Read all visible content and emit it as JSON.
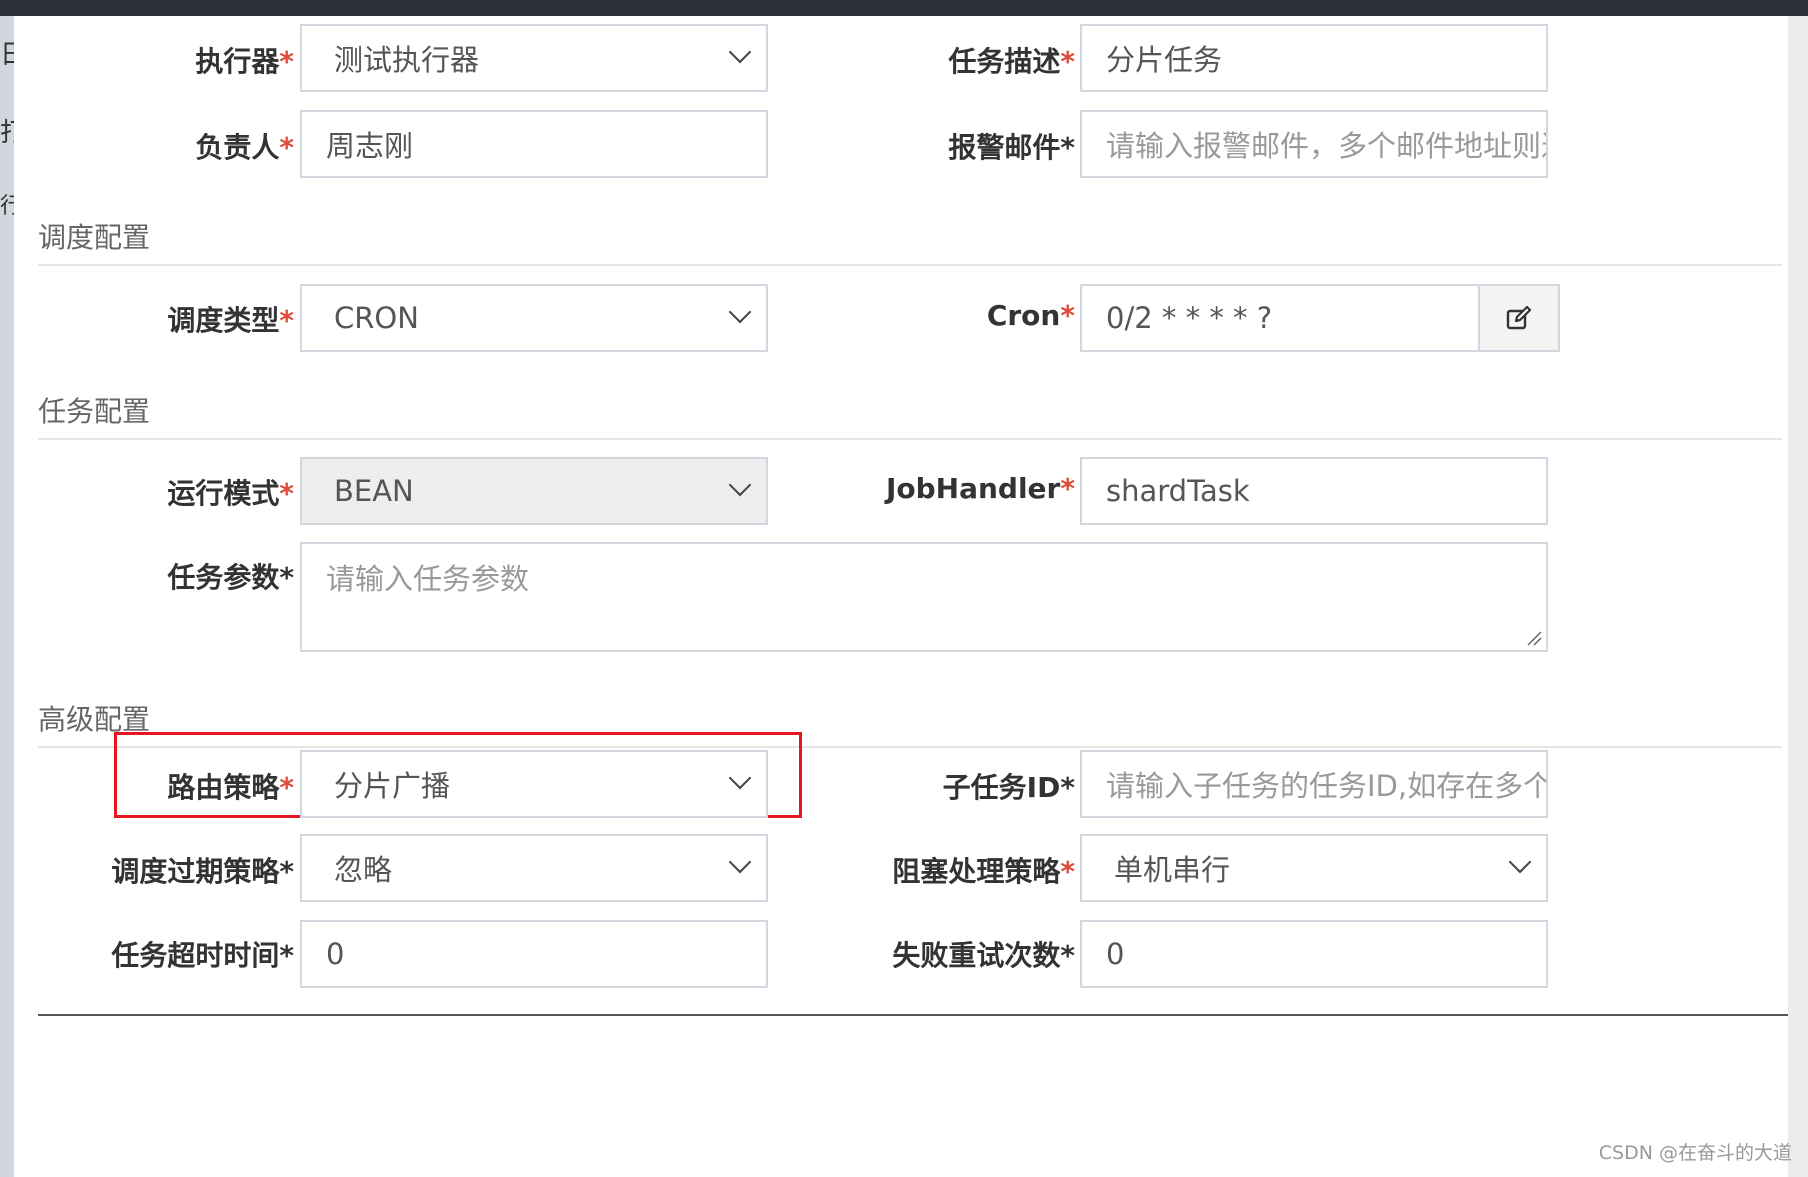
{
  "left_fragments": [
    "日",
    "打",
    "行"
  ],
  "fields": {
    "executor": {
      "label": "执行器",
      "required": "*",
      "value": "测试执行器"
    },
    "job_desc": {
      "label": "任务描述",
      "required": "*",
      "value": "分片任务"
    },
    "author": {
      "label": "负责人",
      "required": "*",
      "value": "周志刚"
    },
    "alarm_email": {
      "label": "报警邮件",
      "required": "*",
      "placeholder": "请输入报警邮件，多个邮件地址则逗号分"
    },
    "schedule_type": {
      "label": "调度类型",
      "required": "*",
      "value": "CRON"
    },
    "cron": {
      "label": "Cron",
      "required": "*",
      "value": "0/2 * * * * ?"
    },
    "run_mode": {
      "label": "运行模式",
      "required": "*",
      "value": "BEAN"
    },
    "job_handler": {
      "label": "JobHandler",
      "required": "*",
      "value": "shardTask"
    },
    "job_param": {
      "label": "任务参数",
      "required": "*",
      "placeholder": "请输入任务参数"
    },
    "route_strategy": {
      "label": "路由策略",
      "required": "*",
      "value": "分片广播"
    },
    "child_job_id": {
      "label": "子任务ID",
      "required": "*",
      "placeholder": "请输入子任务的任务ID,如存在多个则逗号"
    },
    "misfire_strategy": {
      "label": "调度过期策略",
      "required": "*",
      "value": "忽略"
    },
    "block_strategy": {
      "label": "阻塞处理策略",
      "required": "*",
      "value": "单机串行"
    },
    "timeout": {
      "label": "任务超时时间",
      "required": "*",
      "value": "0"
    },
    "fail_retry": {
      "label": "失败重试次数",
      "required": "*",
      "value": "0"
    }
  },
  "sections": {
    "schedule": "调度配置",
    "job": "任务配置",
    "advanced": "高级配置"
  },
  "icons": {
    "cron_edit": "edit-icon"
  },
  "colors": {
    "required": "#dd4b39",
    "highlight": "#e5161f"
  },
  "watermark": "CSDN @在奋斗的大道"
}
